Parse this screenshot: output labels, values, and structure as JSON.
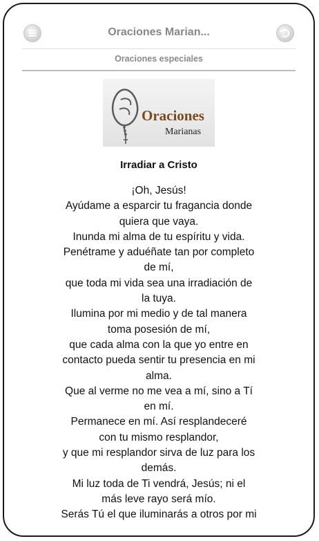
{
  "header": {
    "title": "Oraciones Marian...",
    "menu_icon": "menu-icon",
    "back_icon": "back-icon"
  },
  "subheader": {
    "label": "Oraciones especiales"
  },
  "logo": {
    "line1": "Oraciones",
    "line2": "Marianas",
    "color": "#7a4a1c"
  },
  "prayer": {
    "title": "Irradiar a Cristo",
    "lines": [
      "¡Oh, Jesús!",
      "Ayúdame a esparcir tu fragancia donde",
      "quiera que vaya.",
      "Inunda mi alma de tu espíritu y vida.",
      "Penétrame y aduéñate tan por completo",
      "de mí,",
      "que toda mi vida sea una irradiación de",
      "la tuya.",
      "Ilumina por mi medio y de tal manera",
      "toma posesión de mí,",
      "que cada alma con la que yo entre en",
      "contacto pueda sentir tu presencia en mi",
      "alma.",
      "Que al verme no me vea a mí, sino a Tí",
      "en mí.",
      "Permanece en mí. Así resplandeceré",
      "con tu mismo resplandor,",
      "y que mi resplandor sirva de luz para los",
      "demás.",
      "Mi luz toda de Ti vendrá, Jesús; ni el",
      "más leve rayo será mío.",
      "Serás Tú el que iluminarás a otros por mi"
    ]
  }
}
